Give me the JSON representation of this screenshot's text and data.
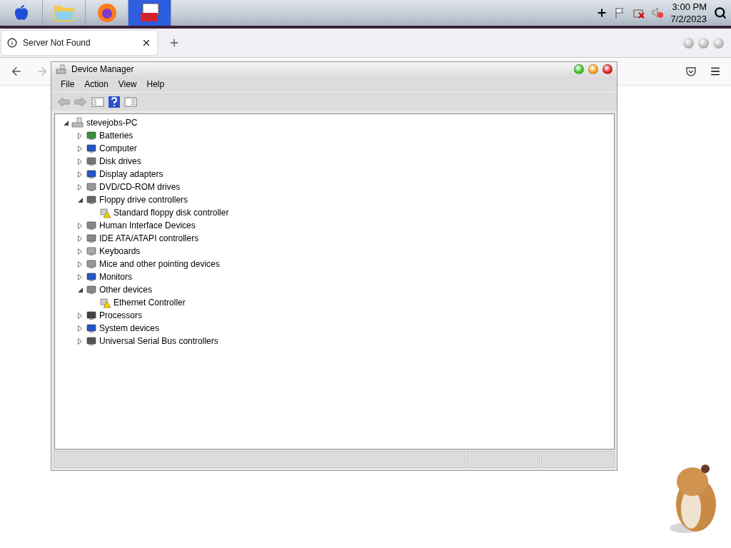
{
  "taskbar": {
    "apps": [
      {
        "selected": false
      },
      {
        "selected": false
      },
      {
        "selected": true
      }
    ],
    "clock": {
      "time": "3:00 PM",
      "date": "7/2/2023"
    }
  },
  "browser": {
    "tab": {
      "title": "Server Not Found",
      "selected": true
    }
  },
  "device_manager": {
    "window": {
      "title": "Device Manager"
    },
    "menu": [
      "File",
      "Action",
      "View",
      "Help"
    ],
    "tree": {
      "label": "stevejobs-PC",
      "expanded": true,
      "children": [
        {
          "label": "Batteries",
          "expanded": false
        },
        {
          "label": "Computer",
          "expanded": false
        },
        {
          "label": "Disk drives",
          "expanded": false
        },
        {
          "label": "Display adapters",
          "expanded": false
        },
        {
          "label": "DVD/CD-ROM drives",
          "expanded": false
        },
        {
          "label": "Floppy drive controllers",
          "expanded": true,
          "children": [
            {
              "label": "Standard floppy disk controller",
              "warning": true
            }
          ]
        },
        {
          "label": "Human Interface Devices",
          "expanded": false
        },
        {
          "label": "IDE ATA/ATAPI controllers",
          "expanded": false
        },
        {
          "label": "Keyboards",
          "expanded": false
        },
        {
          "label": "Mice and other pointing devices",
          "expanded": false
        },
        {
          "label": "Monitors",
          "expanded": false
        },
        {
          "label": "Other devices",
          "expanded": true,
          "children": [
            {
              "label": "Ethernet Controller",
              "warning": true
            }
          ]
        },
        {
          "label": "Processors",
          "expanded": false
        },
        {
          "label": "System devices",
          "expanded": false
        },
        {
          "label": "Universal Serial Bus controllers",
          "expanded": false
        }
      ]
    }
  }
}
